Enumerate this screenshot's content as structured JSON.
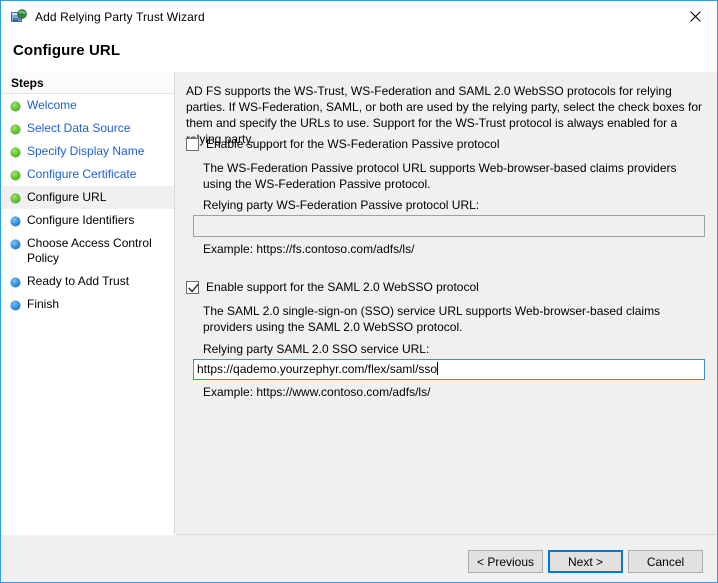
{
  "window": {
    "title": "Add Relying Party Trust Wizard",
    "icon": "wizard-globe-icon",
    "close_glyph": "close-icon",
    "border_color": "#2f9ae8"
  },
  "header": {
    "title": "Configure URL"
  },
  "steps": {
    "heading": "Steps",
    "items": [
      {
        "label": "Welcome",
        "state": "completed",
        "bullet": "green"
      },
      {
        "label": "Select Data Source",
        "state": "completed",
        "bullet": "green"
      },
      {
        "label": "Specify Display Name",
        "state": "completed",
        "bullet": "green"
      },
      {
        "label": "Configure Certificate",
        "state": "completed",
        "bullet": "green"
      },
      {
        "label": "Configure URL",
        "state": "current",
        "bullet": "green"
      },
      {
        "label": "Configure Identifiers",
        "state": "upcoming",
        "bullet": "blue"
      },
      {
        "label": "Choose Access Control Policy",
        "state": "upcoming",
        "bullet": "blue"
      },
      {
        "label": "Ready to Add Trust",
        "state": "upcoming",
        "bullet": "blue"
      },
      {
        "label": "Finish",
        "state": "upcoming",
        "bullet": "blue"
      }
    ]
  },
  "main": {
    "intro": "AD FS supports the WS-Trust, WS-Federation and SAML 2.0 WebSSO protocols for relying parties.  If WS-Federation, SAML, or both are used by the relying party, select the check boxes for them and specify the URLs to use.  Support for the WS-Trust protocol is always enabled for a relying party.",
    "wsfed": {
      "checkbox_label": "Enable support for the WS-Federation Passive protocol",
      "checked": false,
      "description": "The WS-Federation Passive protocol URL supports Web-browser-based claims providers using the WS-Federation Passive protocol.",
      "field_label": "Relying party WS-Federation Passive protocol URL:",
      "field_value": "",
      "example": "Example: https://fs.contoso.com/adfs/ls/"
    },
    "saml": {
      "checkbox_label": "Enable support for the SAML 2.0 WebSSO protocol",
      "checked": true,
      "description": "The SAML 2.0 single-sign-on (SSO) service URL supports Web-browser-based claims providers using the SAML 2.0 WebSSO protocol.",
      "field_label": "Relying party SAML 2.0 SSO service URL:",
      "field_value": "https://qademo.yourzephyr.com/flex/saml/sso",
      "example": "Example: https://www.contoso.com/adfs/ls/"
    }
  },
  "footer": {
    "previous_label": "< Previous",
    "next_label": "Next >",
    "cancel_label": "Cancel",
    "default_button": "next",
    "focus_color": "#0078d7"
  }
}
